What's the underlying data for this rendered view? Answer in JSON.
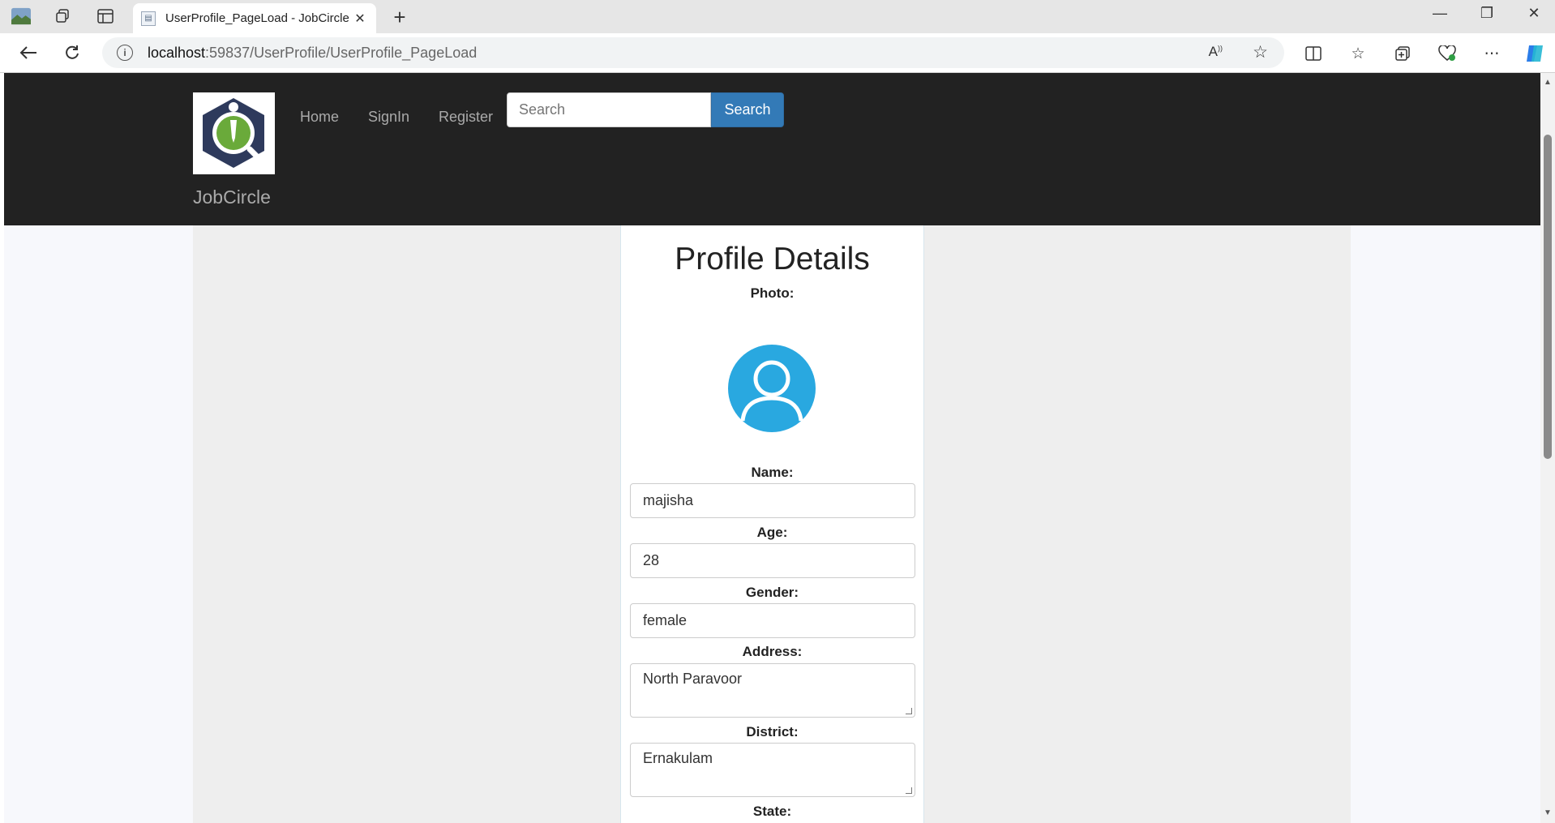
{
  "browser": {
    "tab_title": "UserProfile_PageLoad - JobCircle",
    "tab_close": "✕",
    "new_tab": "+",
    "url_host": "localhost",
    "url_path": ":59837/UserProfile/UserProfile_PageLoad",
    "window_controls": {
      "minimize": "—",
      "restore": "❐",
      "close": "✕"
    }
  },
  "navbar": {
    "brand": "JobCircle",
    "links": [
      "Home",
      "SignIn",
      "Register"
    ],
    "search_placeholder": "Search",
    "search_button": "Search"
  },
  "profile": {
    "heading": "Profile Details",
    "photo_label": "Photo:",
    "name_label": "Name:",
    "name_value": "majisha",
    "age_label": "Age:",
    "age_value": "28",
    "gender_label": "Gender:",
    "gender_value": "female",
    "address_label": "Address:",
    "address_value": "North Paravoor",
    "district_label": "District:",
    "district_value": "Ernakulam",
    "state_label": "State:"
  },
  "colors": {
    "navbar_bg": "#222222",
    "search_button": "#337ab7",
    "avatar": "#29a8e0",
    "logo_dark": "#2e3a5c",
    "logo_green": "#6aaa3a"
  }
}
